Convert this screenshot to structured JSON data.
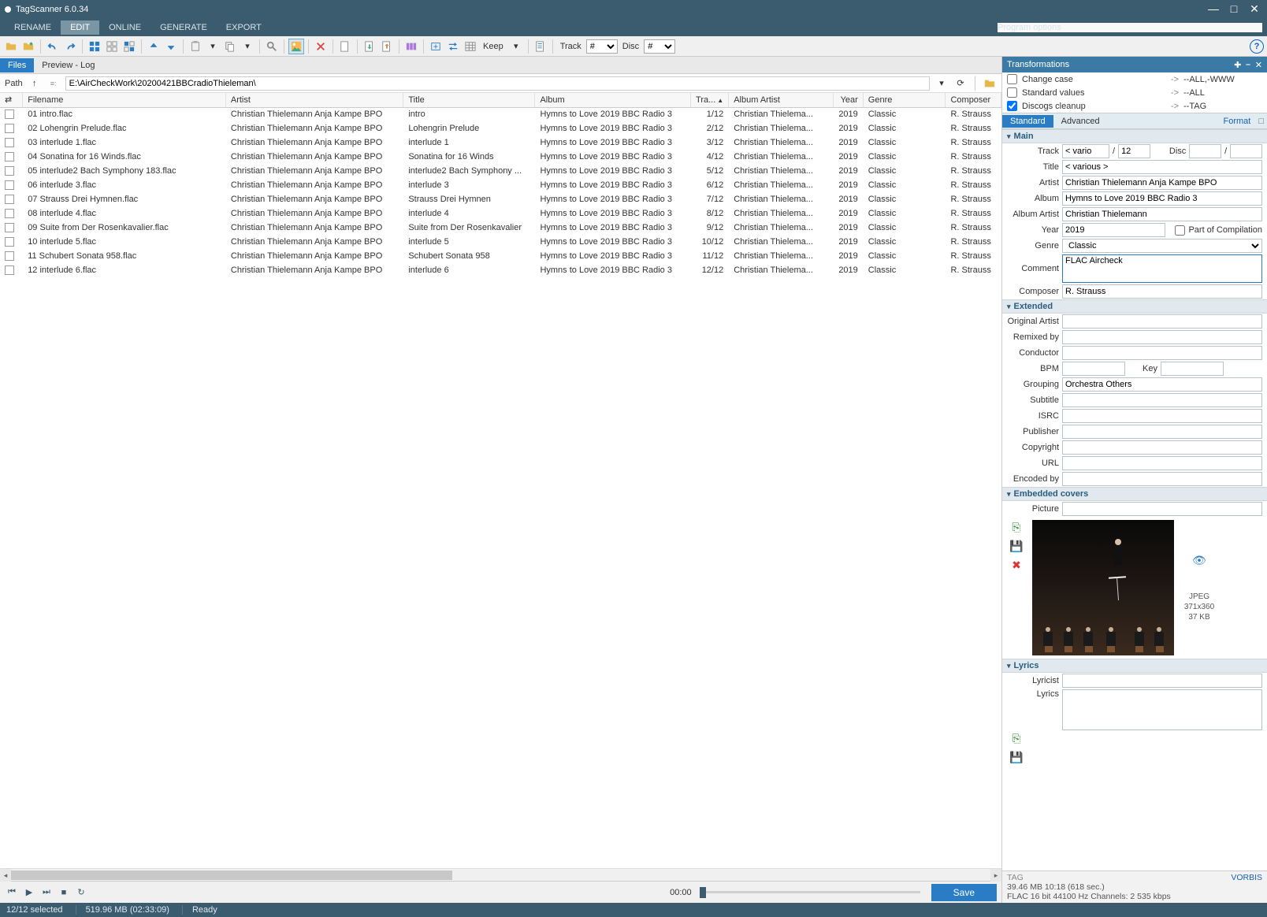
{
  "app": {
    "title": "TagScanner 6.0.34",
    "program_options": "Program options"
  },
  "menu": [
    "RENAME",
    "EDIT",
    "ONLINE",
    "GENERATE",
    "EXPORT"
  ],
  "menu_active": 1,
  "toolbar": {
    "keep_label": "Keep",
    "track_label": "Track",
    "track_value": "#",
    "disc_label": "Disc",
    "disc_value": "#"
  },
  "left_tabs": [
    "Files",
    "Preview - Log"
  ],
  "left_tab_active": 0,
  "path": {
    "label": "Path",
    "value": "E:\\AirCheckWork\\20200421BBCradioThieleman\\"
  },
  "columns": [
    "Filename",
    "Artist",
    "Title",
    "Album",
    "Tra...",
    "Album Artist",
    "Year",
    "Genre",
    "Composer"
  ],
  "rows": [
    {
      "filename": "01 intro.flac",
      "artist": "Christian Thielemann Anja Kampe BPO",
      "title": "intro",
      "album": "Hymns to Love 2019 BBC Radio 3",
      "track": "1/12",
      "albumartist": "Christian Thielema...",
      "year": "2019",
      "genre": "Classic",
      "composer": "R. Strauss"
    },
    {
      "filename": "02 Lohengrin Prelude.flac",
      "artist": "Christian Thielemann Anja Kampe BPO",
      "title": "Lohengrin Prelude",
      "album": "Hymns to Love 2019 BBC Radio 3",
      "track": "2/12",
      "albumartist": "Christian Thielema...",
      "year": "2019",
      "genre": "Classic",
      "composer": "R. Strauss"
    },
    {
      "filename": "03 interlude 1.flac",
      "artist": "Christian Thielemann Anja Kampe BPO",
      "title": "interlude 1",
      "album": "Hymns to Love 2019 BBC Radio 3",
      "track": "3/12",
      "albumartist": "Christian Thielema...",
      "year": "2019",
      "genre": "Classic",
      "composer": "R. Strauss"
    },
    {
      "filename": "04 Sonatina for 16 Winds.flac",
      "artist": "Christian Thielemann Anja Kampe BPO",
      "title": "Sonatina for 16 Winds",
      "album": "Hymns to Love 2019 BBC Radio 3",
      "track": "4/12",
      "albumartist": "Christian Thielema...",
      "year": "2019",
      "genre": "Classic",
      "composer": "R. Strauss"
    },
    {
      "filename": "05 interlude2 Bach Symphony 183.flac",
      "artist": "Christian Thielemann Anja Kampe BPO",
      "title": "interlude2 Bach Symphony ...",
      "album": "Hymns to Love 2019 BBC Radio 3",
      "track": "5/12",
      "albumartist": "Christian Thielema...",
      "year": "2019",
      "genre": "Classic",
      "composer": "R. Strauss"
    },
    {
      "filename": "06 interlude 3.flac",
      "artist": "Christian Thielemann Anja Kampe BPO",
      "title": "interlude 3",
      "album": "Hymns to Love 2019 BBC Radio 3",
      "track": "6/12",
      "albumartist": "Christian Thielema...",
      "year": "2019",
      "genre": "Classic",
      "composer": "R. Strauss"
    },
    {
      "filename": "07 Strauss Drei Hymnen.flac",
      "artist": "Christian Thielemann Anja Kampe BPO",
      "title": "Strauss Drei Hymnen",
      "album": "Hymns to Love 2019 BBC Radio 3",
      "track": "7/12",
      "albumartist": "Christian Thielema...",
      "year": "2019",
      "genre": "Classic",
      "composer": "R. Strauss"
    },
    {
      "filename": "08 interlude 4.flac",
      "artist": "Christian Thielemann Anja Kampe BPO",
      "title": "interlude 4",
      "album": "Hymns to Love 2019 BBC Radio 3",
      "track": "8/12",
      "albumartist": "Christian Thielema...",
      "year": "2019",
      "genre": "Classic",
      "composer": "R. Strauss"
    },
    {
      "filename": "09 Suite from Der Rosenkavalier.flac",
      "artist": "Christian Thielemann Anja Kampe BPO",
      "title": "Suite from Der Rosenkavalier",
      "album": "Hymns to Love 2019 BBC Radio 3",
      "track": "9/12",
      "albumartist": "Christian Thielema...",
      "year": "2019",
      "genre": "Classic",
      "composer": "R. Strauss"
    },
    {
      "filename": "10 interlude 5.flac",
      "artist": "Christian Thielemann Anja Kampe BPO",
      "title": "interlude 5",
      "album": "Hymns to Love 2019 BBC Radio 3",
      "track": "10/12",
      "albumartist": "Christian Thielema...",
      "year": "2019",
      "genre": "Classic",
      "composer": "R. Strauss"
    },
    {
      "filename": "11 Schubert Sonata 958.flac",
      "artist": "Christian Thielemann Anja Kampe BPO",
      "title": "Schubert Sonata 958",
      "album": "Hymns to Love 2019 BBC Radio 3",
      "track": "11/12",
      "albumartist": "Christian Thielema...",
      "year": "2019",
      "genre": "Classic",
      "composer": "R. Strauss"
    },
    {
      "filename": "12 interlude 6.flac",
      "artist": "Christian Thielemann Anja Kampe BPO",
      "title": "interlude 6",
      "album": "Hymns to Love 2019 BBC Radio 3",
      "track": "12/12",
      "albumartist": "Christian Thielema...",
      "year": "2019",
      "genre": "Classic",
      "composer": "R. Strauss"
    }
  ],
  "playback": {
    "time": "00:00",
    "save": "Save"
  },
  "trans": {
    "header": "Transformations",
    "items": [
      {
        "checked": false,
        "name": "Change case",
        "target": "--ALL,-WWW"
      },
      {
        "checked": false,
        "name": "Standard values",
        "target": "--ALL"
      },
      {
        "checked": true,
        "name": "Discogs cleanup",
        "target": "--TAG"
      }
    ]
  },
  "edit_tabs": [
    "Standard",
    "Advanced"
  ],
  "edit_tab_active": 0,
  "format_link": "Format",
  "sections": {
    "main": "Main",
    "extended": "Extended",
    "covers": "Embedded covers",
    "lyrics": "Lyrics"
  },
  "fields": {
    "track_label": "Track",
    "track_val": "< vario",
    "track_total": "12",
    "disc_label": "Disc",
    "disc_val": "",
    "disc_total": "",
    "title_label": "Title",
    "title_val": "< various >",
    "artist_label": "Artist",
    "artist_val": "Christian Thielemann Anja Kampe BPO",
    "album_label": "Album",
    "album_val": "Hymns to Love 2019 BBC Radio 3",
    "albumartist_label": "Album Artist",
    "albumartist_val": "Christian Thielemann",
    "year_label": "Year",
    "year_val": "2019",
    "compilation_label": "Part of Compilation",
    "genre_label": "Genre",
    "genre_val": "Classic",
    "comment_label": "Comment",
    "comment_val": "FLAC Aircheck",
    "composer_label": "Composer",
    "composer_val": "R. Strauss",
    "origartist_label": "Original Artist",
    "origartist_val": "",
    "remixed_label": "Remixed by",
    "remixed_val": "",
    "conductor_label": "Conductor",
    "conductor_val": "",
    "bpm_label": "BPM",
    "bpm_val": "",
    "key_label": "Key",
    "key_val": "",
    "grouping_label": "Grouping",
    "grouping_val": "Orchestra Others",
    "subtitle_label": "Subtitle",
    "subtitle_val": "",
    "isrc_label": "ISRC",
    "isrc_val": "",
    "publisher_label": "Publisher",
    "publisher_val": "",
    "copyright_label": "Copyright",
    "copyright_val": "",
    "url_label": "URL",
    "url_val": "",
    "encoded_label": "Encoded by",
    "encoded_val": "",
    "picture_label": "Picture",
    "picture_val": "",
    "cover_format": "JPEG",
    "cover_dims": "371x360",
    "cover_size": "37 KB",
    "lyricist_label": "Lyricist",
    "lyricist_val": "",
    "lyrics_label": "Lyrics",
    "lyrics_val": ""
  },
  "taginfo": {
    "tag": "TAG",
    "vorbis": "VORBIS",
    "line1": "39.46 MB  10:18 (618 sec.)",
    "line2": "FLAC  16 bit  44100 Hz  Channels: 2  535 kbps"
  },
  "status": {
    "selected": "12/12 selected",
    "size": "519.96 MB (02:33:09)",
    "ready": "Ready"
  }
}
